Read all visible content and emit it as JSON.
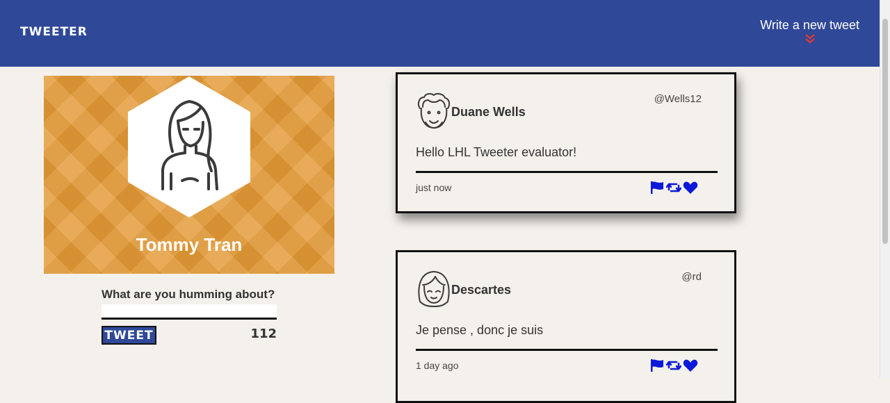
{
  "nav": {
    "brand": "TWEETER",
    "compose_label": "Write a new tweet",
    "compose_icon": "double-chevron-down-icon",
    "compose_icon_color": "#d33b3b",
    "background": "#2f4898"
  },
  "profile": {
    "name": "Tommy Tran",
    "avatar_icon": "user-avatar-icon",
    "background": "#e49a36"
  },
  "composer": {
    "label": "What are you humming about?",
    "value": "",
    "button_label": "TWEET",
    "counter": "112"
  },
  "tweets": [
    {
      "author": "Duane Wells",
      "handle": "@Wells12",
      "content": "Hello LHL Tweeter evaluator!",
      "timestamp": "just now",
      "avatar_icon": "curly-hair-avatar-icon"
    },
    {
      "author": "Descartes",
      "handle": "@rd",
      "content": "Je pense , donc je suis",
      "timestamp": "1 day ago",
      "avatar_icon": "bob-hair-avatar-icon"
    }
  ],
  "actions": {
    "flag_icon": "flag-icon",
    "retweet_icon": "retweet-icon",
    "like_icon": "heart-icon",
    "color": "#0b19d8"
  }
}
